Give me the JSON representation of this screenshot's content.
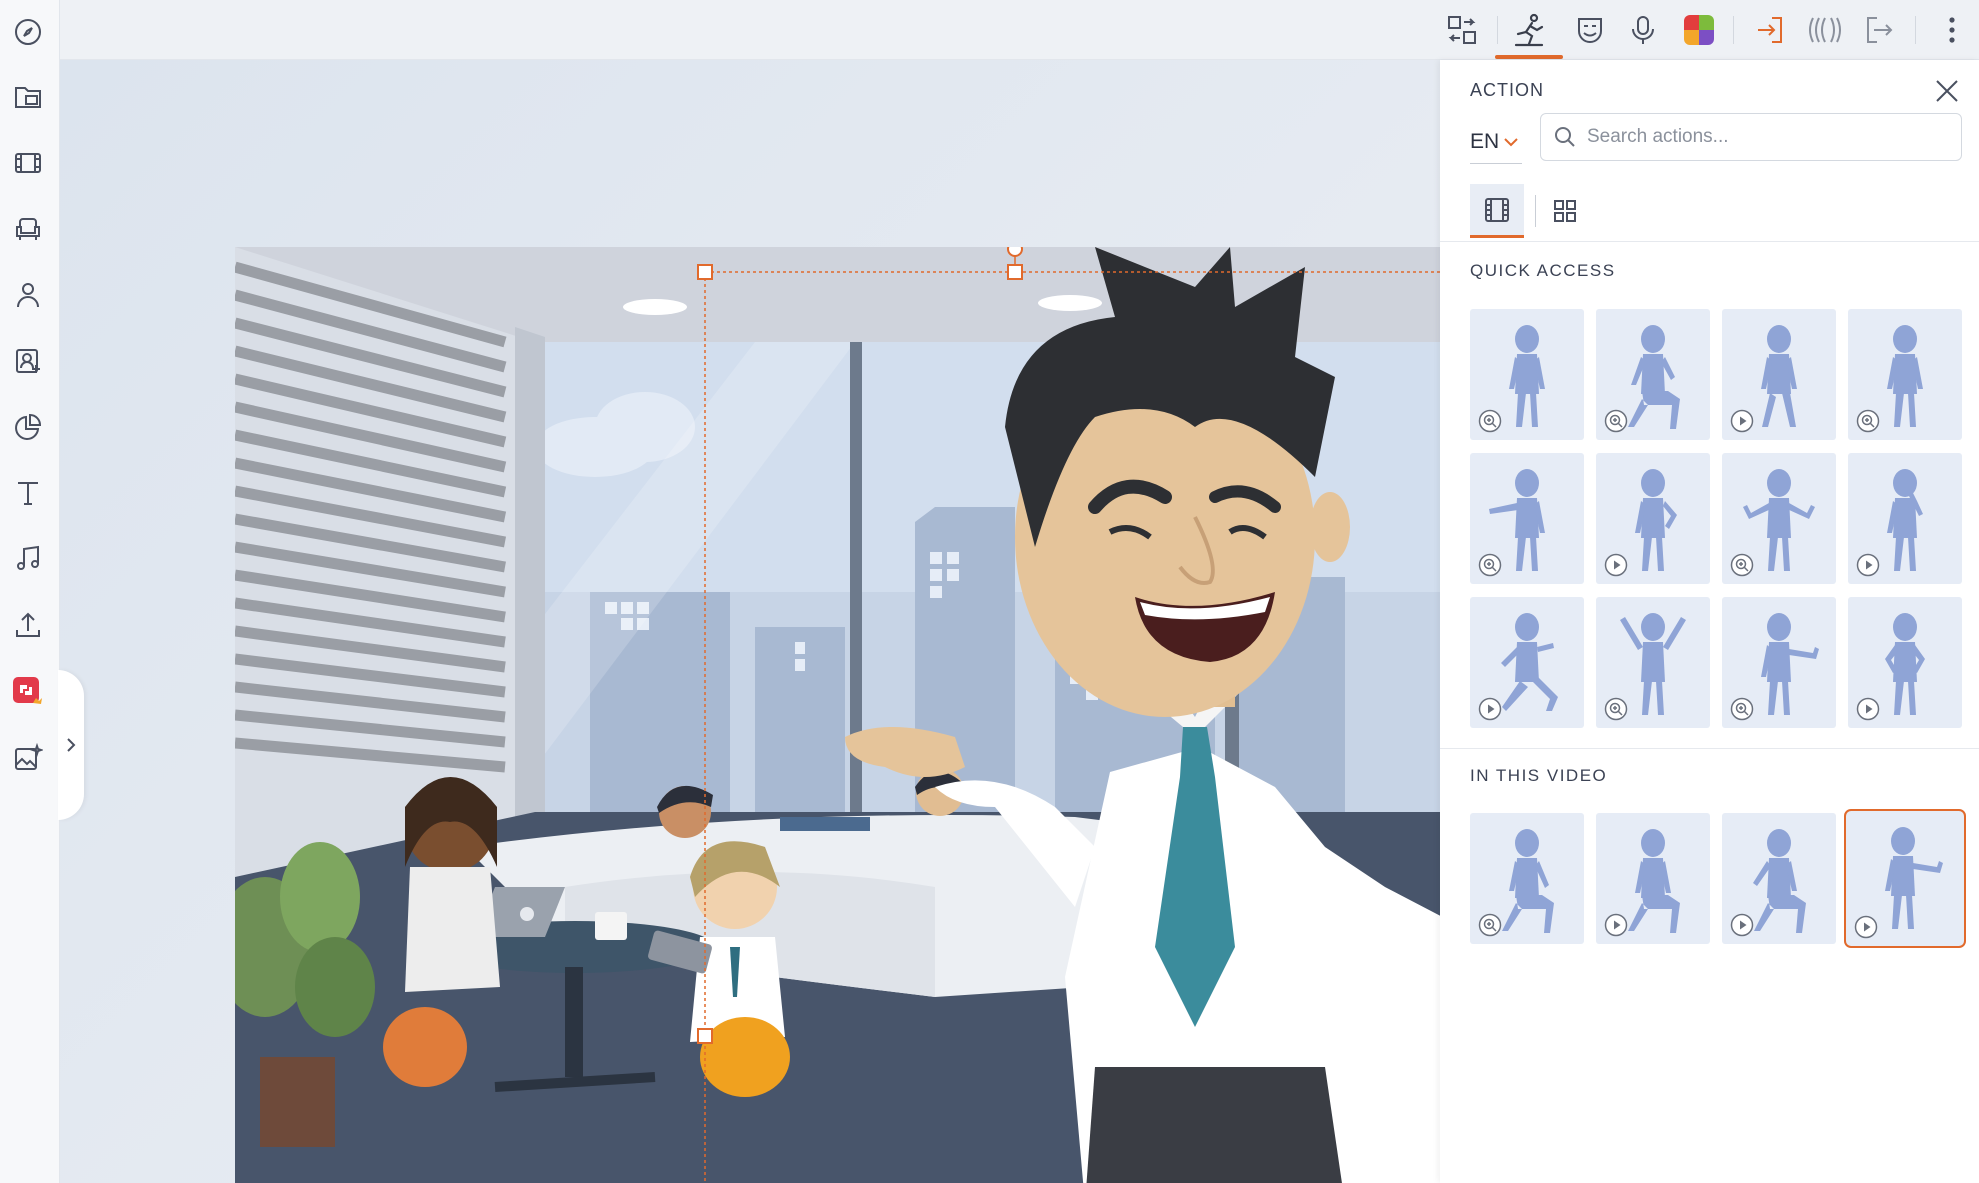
{
  "panel": {
    "title": "ACTION",
    "language": "EN",
    "search_placeholder": "Search actions...",
    "quick_access_label": "QUICK ACCESS",
    "in_video_label": "IN THIS VIDEO"
  },
  "quick_access": [
    {
      "pose": "stand-calm",
      "badge": "zoom-icon"
    },
    {
      "pose": "lean-sit",
      "badge": "zoom-icon"
    },
    {
      "pose": "stand-walk",
      "badge": "play-icon"
    },
    {
      "pose": "stand-side",
      "badge": "zoom-icon"
    },
    {
      "pose": "point-left",
      "badge": "zoom-icon"
    },
    {
      "pose": "hand-on-hip",
      "badge": "play-icon"
    },
    {
      "pose": "shrug",
      "badge": "zoom-icon"
    },
    {
      "pose": "thinking",
      "badge": "play-icon"
    },
    {
      "pose": "running",
      "badge": "play-icon"
    },
    {
      "pose": "arms-up",
      "badge": "zoom-icon"
    },
    {
      "pose": "present-right",
      "badge": "zoom-icon"
    },
    {
      "pose": "stand-hips",
      "badge": "play-icon"
    }
  ],
  "in_this_video": [
    {
      "pose": "sit-forward",
      "badge": "zoom-icon",
      "selected": false
    },
    {
      "pose": "sit-relaxed",
      "badge": "play-icon",
      "selected": false
    },
    {
      "pose": "sit-talk",
      "badge": "play-icon",
      "selected": false
    },
    {
      "pose": "present-right",
      "badge": "play-icon",
      "selected": true
    }
  ],
  "colors": {
    "accent": "#e16a2c",
    "figure": "#8fa4d6",
    "tile_bg": "#e6ecf6",
    "icon": "#4a5060"
  },
  "sidebar_icons": [
    "compass-icon",
    "folder-video-icon",
    "film-icon",
    "armchair-icon",
    "person-icon",
    "character-builder-icon",
    "pie-chart-icon",
    "text-icon",
    "music-icon",
    "upload-icon",
    "premium-plugin-icon",
    "image-magic-icon"
  ],
  "toolbar_icons": [
    "swap-icon",
    "action-icon",
    "expression-icon",
    "microphone-icon",
    "color-icon",
    "enter-icon",
    "motion-icon",
    "exit-icon",
    "more-icon"
  ]
}
